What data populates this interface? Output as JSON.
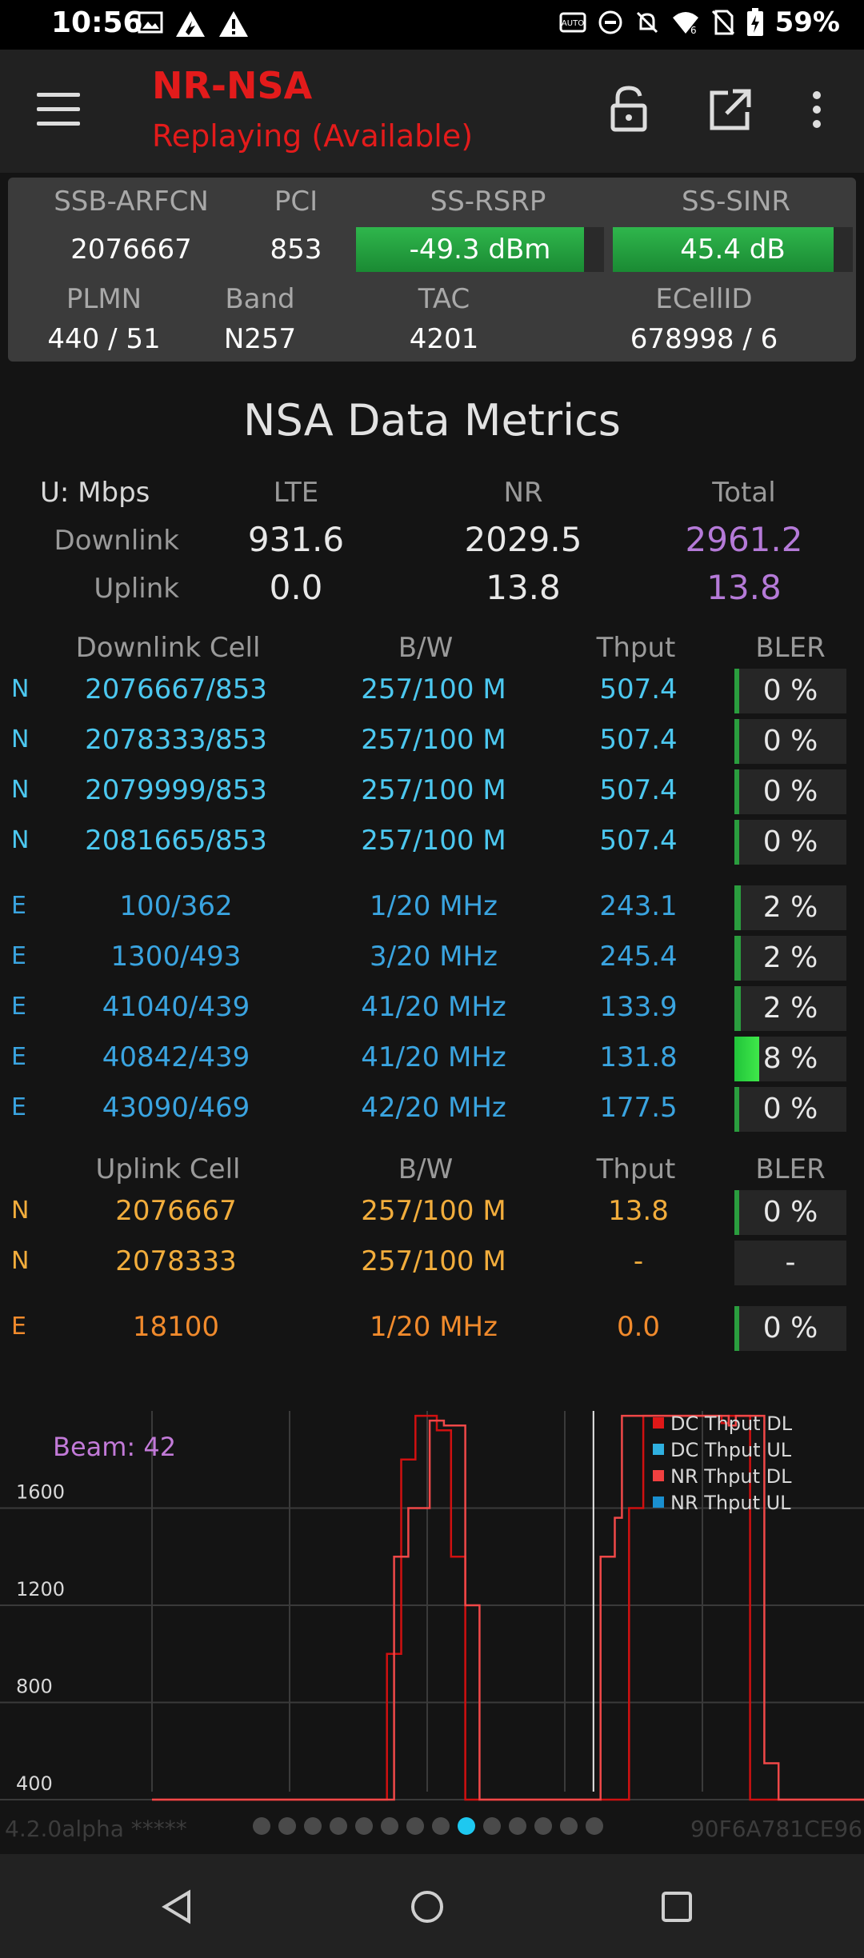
{
  "status_bar": {
    "time": "10:56",
    "battery": "59%"
  },
  "app_bar": {
    "title": "NR-NSA",
    "subtitle": "Replaying (Available)"
  },
  "cell_info": {
    "labels": {
      "arfcn": "SSB-ARFCN",
      "pci": "PCI",
      "rsrp": "SS-RSRP",
      "sinr": "SS-SINR",
      "plmn": "PLMN",
      "band": "Band",
      "tac": "TAC",
      "ecellid": "ECellID"
    },
    "values": {
      "arfcn": "2076667",
      "pci": "853",
      "rsrp": "-49.3 dBm",
      "sinr": "45.4 dB",
      "plmn": "440 / 51",
      "band": "N257",
      "tac": "4201",
      "ecellid": "678998 / 6"
    },
    "rsrp_level": 0.92,
    "sinr_level": 0.92
  },
  "metrics": {
    "title": "NSA Data Metrics",
    "unit": "U: Mbps",
    "col_lte": "LTE",
    "col_nr": "NR",
    "col_total": "Total",
    "downlink": {
      "label": "Downlink",
      "lte": "931.6",
      "nr": "2029.5",
      "total": "2961.2"
    },
    "uplink": {
      "label": "Uplink",
      "lte": "0.0",
      "nr": "13.8",
      "total": "13.8"
    }
  },
  "dl_table": {
    "headers": {
      "cell": "Downlink Cell",
      "bw": "B/W",
      "thput": "Thput",
      "bler": "BLER"
    },
    "rows": [
      {
        "type": "N",
        "cell": "2076667/853",
        "bw": "257/100 M",
        "thput": "507.4",
        "bler": "0 %",
        "bler_level": 0.04
      },
      {
        "type": "N",
        "cell": "2078333/853",
        "bw": "257/100 M",
        "thput": "507.4",
        "bler": "0 %",
        "bler_level": 0.04
      },
      {
        "type": "N",
        "cell": "2079999/853",
        "bw": "257/100 M",
        "thput": "507.4",
        "bler": "0 %",
        "bler_level": 0.04
      },
      {
        "type": "N",
        "cell": "2081665/853",
        "bw": "257/100 M",
        "thput": "507.4",
        "bler": "0 %",
        "bler_level": 0.04
      },
      {
        "type": "E",
        "cell": "100/362",
        "bw": "1/20 MHz",
        "thput": "243.1",
        "bler": "2 %",
        "bler_level": 0.06
      },
      {
        "type": "E",
        "cell": "1300/493",
        "bw": "3/20 MHz",
        "thput": "245.4",
        "bler": "2 %",
        "bler_level": 0.06
      },
      {
        "type": "E",
        "cell": "41040/439",
        "bw": "41/20 MHz",
        "thput": "133.9",
        "bler": "2 %",
        "bler_level": 0.06
      },
      {
        "type": "E",
        "cell": "40842/439",
        "bw": "41/20 MHz",
        "thput": "131.8",
        "bler": "8 %",
        "bler_level": 0.22
      },
      {
        "type": "E",
        "cell": "43090/469",
        "bw": "42/20 MHz",
        "thput": "177.5",
        "bler": "0 %",
        "bler_level": 0.04
      }
    ]
  },
  "ul_table": {
    "headers": {
      "cell": "Uplink Cell",
      "bw": "B/W",
      "thput": "Thput",
      "bler": "BLER"
    },
    "rows": [
      {
        "type": "N",
        "cell": "2076667",
        "bw": "257/100 M",
        "thput": "13.8",
        "bler": "0 %",
        "bler_level": 0.04
      },
      {
        "type": "N",
        "cell": "2078333",
        "bw": "257/100 M",
        "thput": "-",
        "bler": "-",
        "bler_level": 0
      },
      {
        "type": "E",
        "cell": "18100",
        "bw": "1/20 MHz",
        "thput": "0.0",
        "bler": "0 %",
        "bler_level": 0.04
      }
    ]
  },
  "chart_data": {
    "type": "line",
    "beam_label": "Beam: 42",
    "y_ticks": [
      "1600",
      "1200",
      "800",
      "400"
    ],
    "legend": [
      {
        "name": "DC Thput DL",
        "color": "#e01818"
      },
      {
        "name": "DC Thput UL",
        "color": "#2fb0e0"
      },
      {
        "name": "NR Thput DL",
        "color": "#f04040"
      },
      {
        "name": "NR Thput UL",
        "color": "#1a90d0"
      }
    ],
    "ylim": [
      400,
      2000
    ],
    "xlim": [
      0,
      100
    ],
    "series": [
      {
        "name": "DC Thput DL",
        "color": "#d01010",
        "x": [
          0,
          33,
          33,
          35,
          35,
          37,
          37,
          38,
          38,
          40,
          40,
          42,
          42,
          44,
          44,
          46,
          46,
          67,
          67,
          69,
          69,
          71,
          71,
          80,
          80,
          81,
          81,
          83,
          83,
          84,
          84,
          86,
          86,
          100
        ],
        "y": [
          400,
          400,
          1000,
          1000,
          1800,
          1800,
          1980,
          1980,
          1980,
          1980,
          1920,
          1920,
          1400,
          1400,
          400,
          400,
          400,
          400,
          1600,
          1600,
          1980,
          1980,
          1980,
          1980,
          1950,
          1950,
          1980,
          1980,
          1980,
          1980,
          400,
          400,
          400,
          400
        ]
      },
      {
        "name": "NR Thput DL",
        "color": "#f04848",
        "x": [
          0,
          34,
          34,
          36,
          36,
          39,
          39,
          41,
          41,
          44,
          44,
          46,
          46,
          63,
          63,
          65,
          65,
          66,
          66,
          68,
          68,
          81,
          81,
          82,
          82,
          86,
          86,
          88,
          88,
          100
        ],
        "y": [
          400,
          400,
          1400,
          1400,
          1600,
          1600,
          1960,
          1960,
          1940,
          1940,
          1200,
          1200,
          400,
          400,
          1400,
          1400,
          1560,
          1560,
          1980,
          1980,
          1980,
          1980,
          1940,
          1940,
          1980,
          1980,
          550,
          550,
          400,
          400
        ]
      }
    ],
    "marker_x": 62
  },
  "footer": {
    "version": "4.2.0alpha *****",
    "device_id": "90F6A781CE96",
    "page_count": 14,
    "active_page": 8
  }
}
